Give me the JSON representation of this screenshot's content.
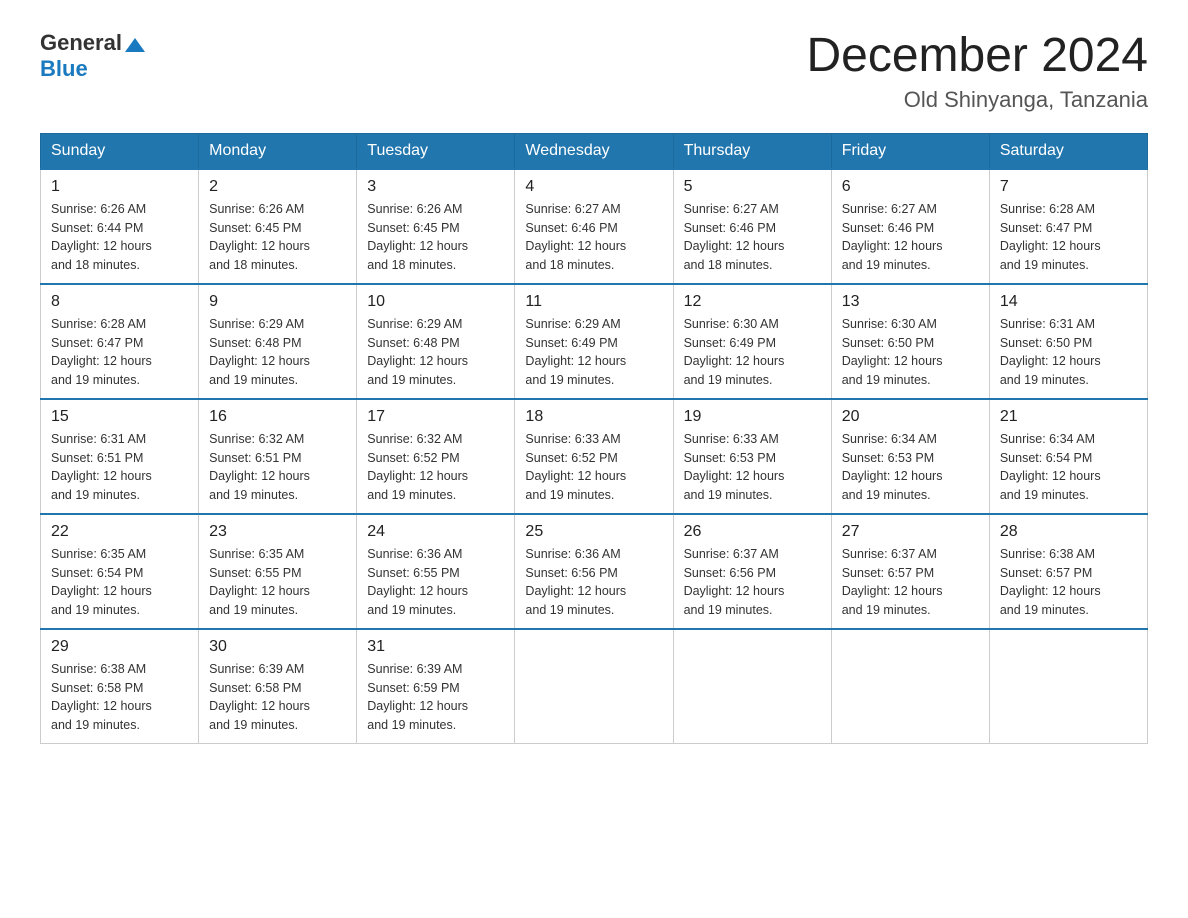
{
  "logo": {
    "general": "General",
    "blue": "Blue",
    "triangle": "▶"
  },
  "header": {
    "month": "December 2024",
    "location": "Old Shinyanga, Tanzania"
  },
  "days_of_week": [
    "Sunday",
    "Monday",
    "Tuesday",
    "Wednesday",
    "Thursday",
    "Friday",
    "Saturday"
  ],
  "weeks": [
    [
      {
        "day": "1",
        "sunrise": "6:26 AM",
        "sunset": "6:44 PM",
        "daylight": "12 hours and 18 minutes."
      },
      {
        "day": "2",
        "sunrise": "6:26 AM",
        "sunset": "6:45 PM",
        "daylight": "12 hours and 18 minutes."
      },
      {
        "day": "3",
        "sunrise": "6:26 AM",
        "sunset": "6:45 PM",
        "daylight": "12 hours and 18 minutes."
      },
      {
        "day": "4",
        "sunrise": "6:27 AM",
        "sunset": "6:46 PM",
        "daylight": "12 hours and 18 minutes."
      },
      {
        "day": "5",
        "sunrise": "6:27 AM",
        "sunset": "6:46 PM",
        "daylight": "12 hours and 18 minutes."
      },
      {
        "day": "6",
        "sunrise": "6:27 AM",
        "sunset": "6:46 PM",
        "daylight": "12 hours and 19 minutes."
      },
      {
        "day": "7",
        "sunrise": "6:28 AM",
        "sunset": "6:47 PM",
        "daylight": "12 hours and 19 minutes."
      }
    ],
    [
      {
        "day": "8",
        "sunrise": "6:28 AM",
        "sunset": "6:47 PM",
        "daylight": "12 hours and 19 minutes."
      },
      {
        "day": "9",
        "sunrise": "6:29 AM",
        "sunset": "6:48 PM",
        "daylight": "12 hours and 19 minutes."
      },
      {
        "day": "10",
        "sunrise": "6:29 AM",
        "sunset": "6:48 PM",
        "daylight": "12 hours and 19 minutes."
      },
      {
        "day": "11",
        "sunrise": "6:29 AM",
        "sunset": "6:49 PM",
        "daylight": "12 hours and 19 minutes."
      },
      {
        "day": "12",
        "sunrise": "6:30 AM",
        "sunset": "6:49 PM",
        "daylight": "12 hours and 19 minutes."
      },
      {
        "day": "13",
        "sunrise": "6:30 AM",
        "sunset": "6:50 PM",
        "daylight": "12 hours and 19 minutes."
      },
      {
        "day": "14",
        "sunrise": "6:31 AM",
        "sunset": "6:50 PM",
        "daylight": "12 hours and 19 minutes."
      }
    ],
    [
      {
        "day": "15",
        "sunrise": "6:31 AM",
        "sunset": "6:51 PM",
        "daylight": "12 hours and 19 minutes."
      },
      {
        "day": "16",
        "sunrise": "6:32 AM",
        "sunset": "6:51 PM",
        "daylight": "12 hours and 19 minutes."
      },
      {
        "day": "17",
        "sunrise": "6:32 AM",
        "sunset": "6:52 PM",
        "daylight": "12 hours and 19 minutes."
      },
      {
        "day": "18",
        "sunrise": "6:33 AM",
        "sunset": "6:52 PM",
        "daylight": "12 hours and 19 minutes."
      },
      {
        "day": "19",
        "sunrise": "6:33 AM",
        "sunset": "6:53 PM",
        "daylight": "12 hours and 19 minutes."
      },
      {
        "day": "20",
        "sunrise": "6:34 AM",
        "sunset": "6:53 PM",
        "daylight": "12 hours and 19 minutes."
      },
      {
        "day": "21",
        "sunrise": "6:34 AM",
        "sunset": "6:54 PM",
        "daylight": "12 hours and 19 minutes."
      }
    ],
    [
      {
        "day": "22",
        "sunrise": "6:35 AM",
        "sunset": "6:54 PM",
        "daylight": "12 hours and 19 minutes."
      },
      {
        "day": "23",
        "sunrise": "6:35 AM",
        "sunset": "6:55 PM",
        "daylight": "12 hours and 19 minutes."
      },
      {
        "day": "24",
        "sunrise": "6:36 AM",
        "sunset": "6:55 PM",
        "daylight": "12 hours and 19 minutes."
      },
      {
        "day": "25",
        "sunrise": "6:36 AM",
        "sunset": "6:56 PM",
        "daylight": "12 hours and 19 minutes."
      },
      {
        "day": "26",
        "sunrise": "6:37 AM",
        "sunset": "6:56 PM",
        "daylight": "12 hours and 19 minutes."
      },
      {
        "day": "27",
        "sunrise": "6:37 AM",
        "sunset": "6:57 PM",
        "daylight": "12 hours and 19 minutes."
      },
      {
        "day": "28",
        "sunrise": "6:38 AM",
        "sunset": "6:57 PM",
        "daylight": "12 hours and 19 minutes."
      }
    ],
    [
      {
        "day": "29",
        "sunrise": "6:38 AM",
        "sunset": "6:58 PM",
        "daylight": "12 hours and 19 minutes."
      },
      {
        "day": "30",
        "sunrise": "6:39 AM",
        "sunset": "6:58 PM",
        "daylight": "12 hours and 19 minutes."
      },
      {
        "day": "31",
        "sunrise": "6:39 AM",
        "sunset": "6:59 PM",
        "daylight": "12 hours and 19 minutes."
      },
      null,
      null,
      null,
      null
    ]
  ],
  "labels": {
    "sunrise": "Sunrise:",
    "sunset": "Sunset:",
    "daylight": "Daylight:"
  }
}
